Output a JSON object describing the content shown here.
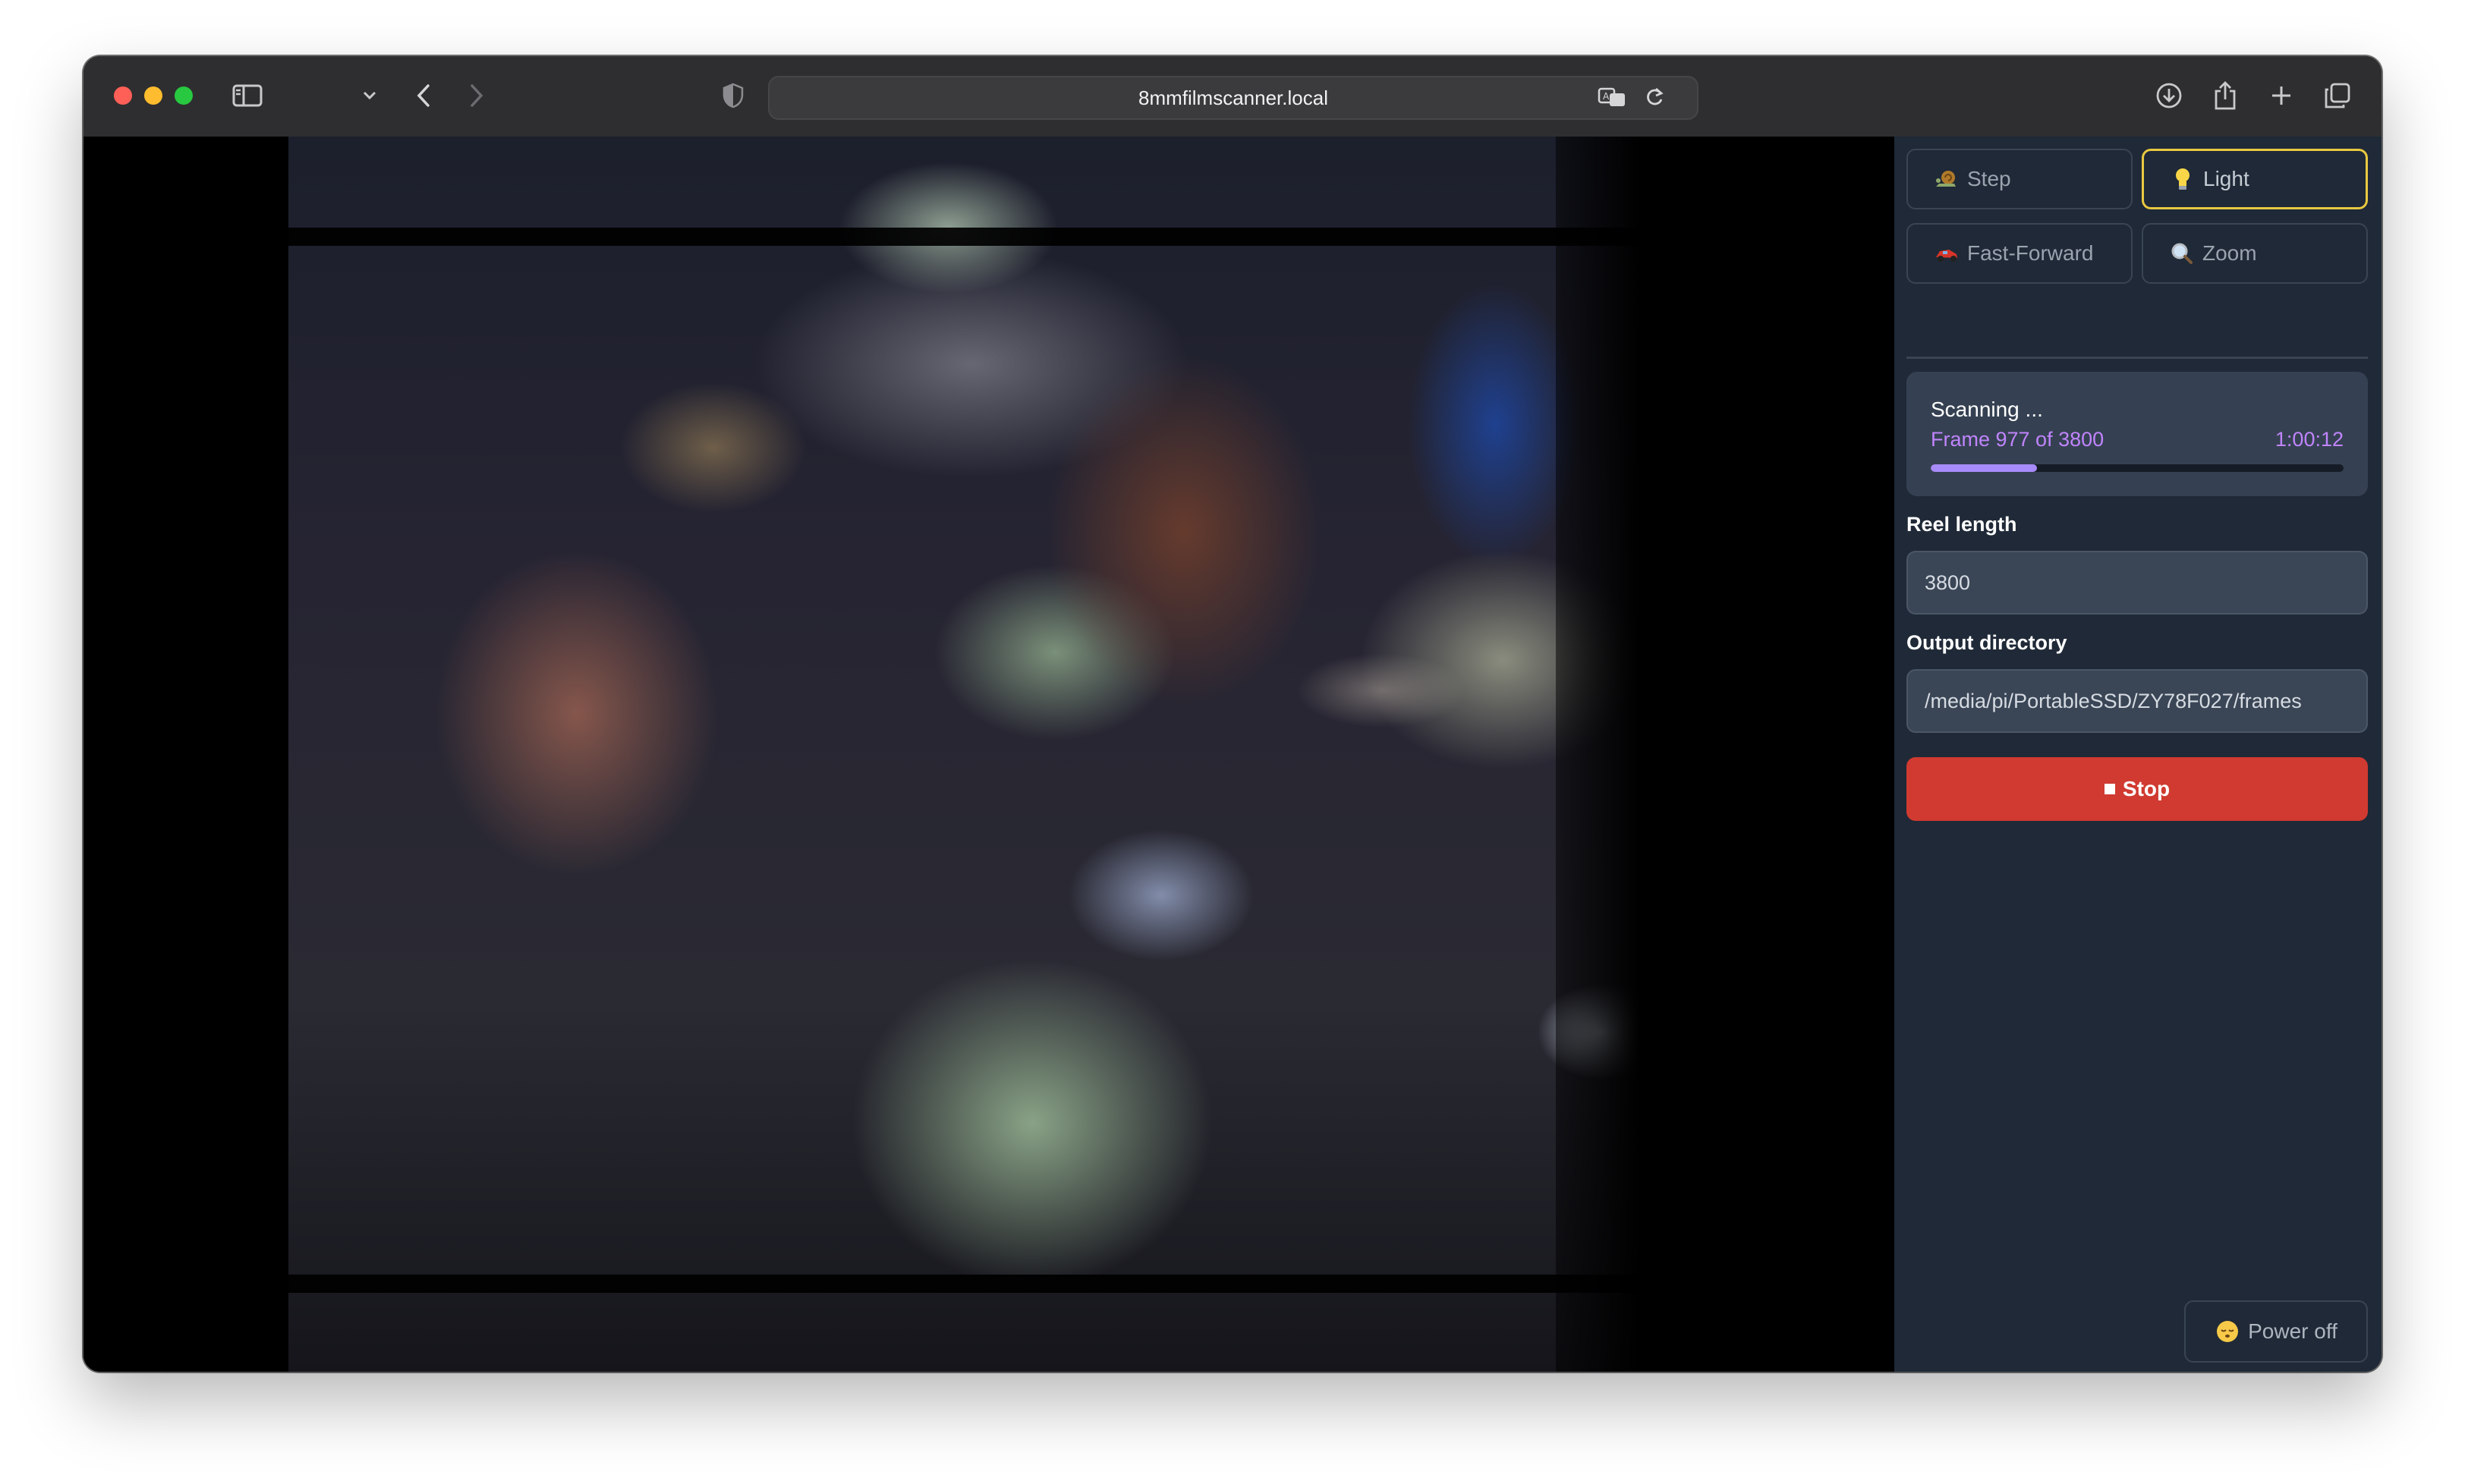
{
  "browser": {
    "url": "8mmfilmscanner.local"
  },
  "controls": {
    "step_label": "Step",
    "light_label": "Light",
    "fast_forward_label": "Fast-Forward",
    "zoom_label": "Zoom"
  },
  "status": {
    "title": "Scanning ...",
    "frame_text": "Frame 977 of 3800",
    "elapsed": "1:00:12",
    "progress_fraction": 0.257
  },
  "reel_length": {
    "label": "Reel length",
    "value": "3800"
  },
  "output_directory": {
    "label": "Output directory",
    "value": "/media/pi/PortableSSD/ZY78F027/frames"
  },
  "stop_label": "Stop",
  "power_off_label": "Power off",
  "colors": {
    "accent_purple": "#c084fc",
    "stop_red": "#d03a30",
    "active_border": "#e8c840",
    "panel_bg": "#1f2937"
  },
  "icons": {
    "step": "snail-icon",
    "light": "lightbulb-icon",
    "fast_forward": "race-car-icon",
    "zoom": "magnifier-icon",
    "power_off": "sleeping-face-icon"
  }
}
